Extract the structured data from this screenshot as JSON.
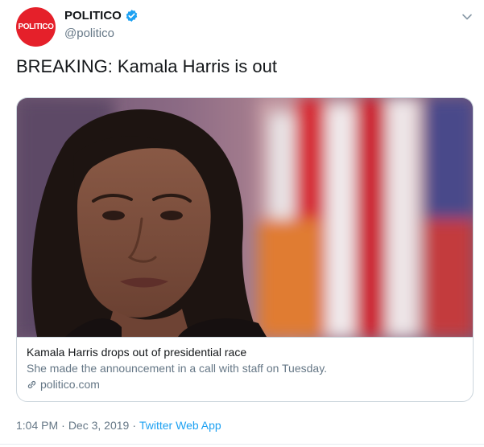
{
  "author": {
    "avatar_text": "POLITICO",
    "name": "POLITICO",
    "handle": "@politico",
    "verified": true
  },
  "tweet": {
    "text": "BREAKING: Kamala Harris is out"
  },
  "card": {
    "title": "Kamala Harris drops out of presidential race",
    "description": "She made the announcement in a call with staff on Tuesday.",
    "domain": "politico.com"
  },
  "meta": {
    "time": "1:04 PM",
    "separator": "·",
    "date": "Dec 3, 2019",
    "source": "Twitter Web App"
  },
  "colors": {
    "brand_red": "#e5202a",
    "verified_blue": "#1da1f2",
    "link_blue": "#1da1f2",
    "secondary_text": "#657786"
  },
  "icons": {
    "verified": "verified-badge-icon",
    "caret": "chevron-down-icon",
    "link": "link-icon"
  }
}
